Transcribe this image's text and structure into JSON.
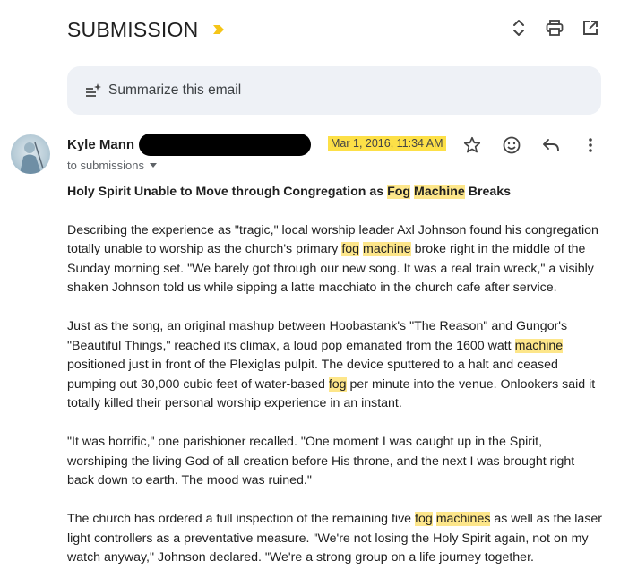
{
  "email": {
    "subject": "SUBMISSION",
    "summarize_label": "Summarize this email",
    "sender_name": "Kyle Mann",
    "date": "Mar 1, 2016, 11:34 AM",
    "recipient": "to submissions"
  },
  "article": {
    "headline": [
      {
        "t": "Holy Spirit Unable to Move through Congregation as "
      },
      {
        "t": "Fog",
        "h": true
      },
      {
        "t": " "
      },
      {
        "t": "Machine",
        "h": true
      },
      {
        "t": " Breaks"
      }
    ],
    "paragraphs": [
      [
        {
          "t": "Describing the experience as \"tragic,\" local worship leader Axl Johnson found his congregation totally unable to worship as the church's primary "
        },
        {
          "t": "fog",
          "h": true
        },
        {
          "t": " "
        },
        {
          "t": "machine",
          "h": true
        },
        {
          "t": " broke right in the middle of the Sunday morning set. \"We barely got through our new song. It was a real train wreck,\" a visibly shaken Johnson told us while sipping a latte macchiato in the church cafe after service."
        }
      ],
      [
        {
          "t": "Just as the song, an original mashup between Hoobastank's \"The Reason\" and Gungor's \"Beautiful Things,\" reached its climax, a loud pop emanated from the 1600 watt "
        },
        {
          "t": "machine",
          "h": true
        },
        {
          "t": " positioned just in front of the Plexiglas pulpit. The device sputtered to a halt and ceased pumping out 30,000 cubic feet of water-based "
        },
        {
          "t": "fog",
          "h": true
        },
        {
          "t": " per minute into the venue. Onlookers said it totally killed their personal worship experience in an instant."
        }
      ],
      [
        {
          "t": "\"It was horrific,\" one parishioner recalled. \"One moment I was caught up in the Spirit, worshiping the living God of all creation before His throne, and the next I was brought right back down to earth. The mood was ruined.\""
        }
      ],
      [
        {
          "t": "The church has ordered a full inspection of the remaining five "
        },
        {
          "t": "fog",
          "h": true
        },
        {
          "t": " "
        },
        {
          "t": "machines",
          "h": true
        },
        {
          "t": " as well as the laser light controllers as a preventative measure. \"We're not losing the Holy Spirit again, not on my watch anyway,\" Johnson declared. \"We're a strong group on a life journey together."
        }
      ]
    ]
  },
  "icons": {
    "importance": "importance-marker-icon",
    "expand": "expand-collapse-icon",
    "print": "print-icon",
    "open_new": "open-in-new-window-icon",
    "summarize": "summarize-sparkle-icon",
    "star": "star-icon",
    "emoji": "emoji-reaction-icon",
    "reply": "reply-icon",
    "more": "more-vert-icon"
  },
  "colors": {
    "highlight": "#fde68a",
    "date_highlight": "#fde047",
    "importance": "#f5c518"
  }
}
